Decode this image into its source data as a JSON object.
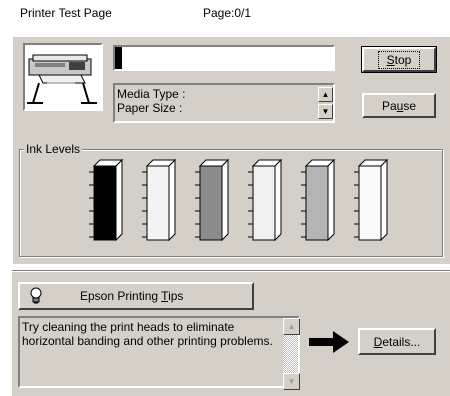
{
  "header": {
    "title": "Printer Test Page",
    "page_label": "Page:0/1"
  },
  "progress": {
    "fraction": 0.03
  },
  "media_info": {
    "media_type_label": "Media Type :",
    "paper_size_label": "Paper Size :"
  },
  "buttons": {
    "stop": {
      "pre": "",
      "key": "S",
      "post": "top"
    },
    "pause": {
      "pre": "Pa",
      "key": "u",
      "post": "se"
    },
    "tips": {
      "pre": "Epson Printing ",
      "key": "T",
      "post": "ips"
    },
    "details": {
      "pre": "",
      "key": "D",
      "post": "etails..."
    }
  },
  "ink_levels": {
    "label": "Ink Levels",
    "cartridges": [
      {
        "color": "#000000"
      },
      {
        "color": "#f4f4f4"
      },
      {
        "color": "#8c8c8c"
      },
      {
        "color": "#f0f0f0"
      },
      {
        "color": "#b4b4b4"
      },
      {
        "color": "#fafafa"
      }
    ]
  },
  "tips_text": "Try cleaning the print heads to eliminate horizontal banding and other printing problems.",
  "icons": {
    "printer": "printer-icon",
    "bulb": "lightbulb-icon",
    "arrow": "right-arrow-icon"
  }
}
